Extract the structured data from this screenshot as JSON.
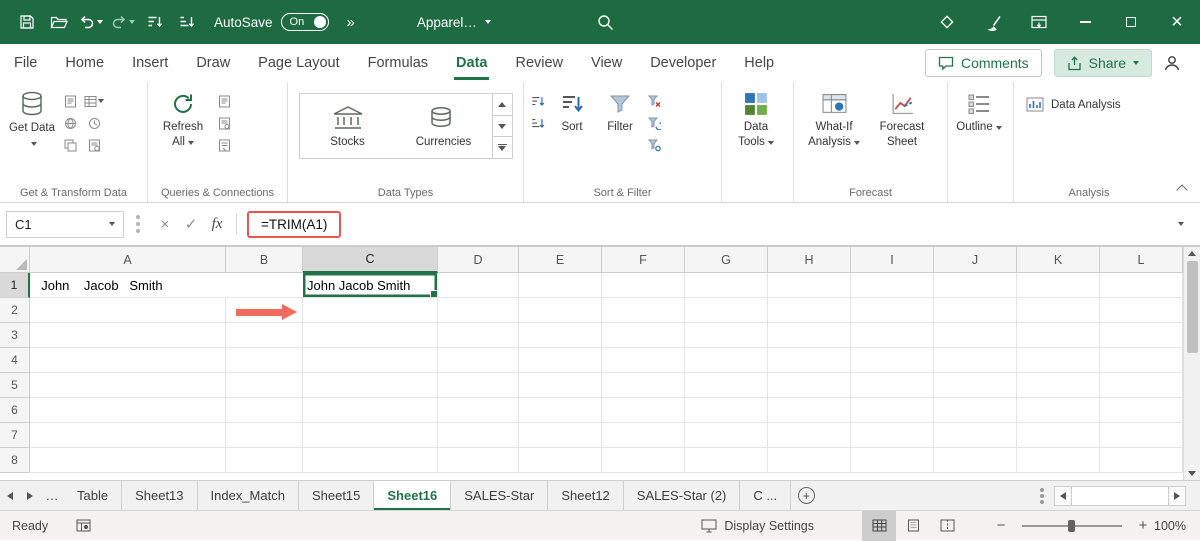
{
  "titlebar": {
    "autosave_label": "AutoSave",
    "autosave_state": "On",
    "overflow_glyph": "»",
    "doc_name": "Apparel…",
    "close_glyph": "×"
  },
  "tabs": {
    "items": [
      "File",
      "Home",
      "Insert",
      "Draw",
      "Page Layout",
      "Formulas",
      "Data",
      "Review",
      "View",
      "Developer",
      "Help"
    ],
    "active": "Data",
    "comments_label": "Comments",
    "share_label": "Share"
  },
  "ribbon": {
    "groups": {
      "get_transform": {
        "label": "Get & Transform Data",
        "get_data": "Get Data"
      },
      "queries": {
        "label": "Queries & Connections",
        "refresh_all": "Refresh All"
      },
      "data_types": {
        "label": "Data Types",
        "items": [
          "Stocks",
          "Currencies"
        ]
      },
      "sort_filter": {
        "label": "Sort & Filter",
        "sort": "Sort",
        "filter": "Filter"
      },
      "data_tools": {
        "button": "Data Tools"
      },
      "forecast": {
        "label": "Forecast",
        "what_if": "What-If Analysis",
        "forecast_sheet": "Forecast Sheet"
      },
      "outline": {
        "button": "Outline"
      },
      "analysis": {
        "label": "Analysis",
        "data_analysis": "Data Analysis"
      }
    }
  },
  "formula_bar": {
    "name_box": "C1",
    "cancel_glyph": "×",
    "enter_glyph": "✓",
    "fx_label": "fx",
    "formula": "=TRIM(A1)"
  },
  "grid": {
    "columns": [
      "A",
      "B",
      "C",
      "D",
      "E",
      "F",
      "G",
      "H",
      "I",
      "J",
      "K",
      "L"
    ],
    "rows": [
      "1",
      "2",
      "3",
      "4",
      "5",
      "6",
      "7",
      "8"
    ],
    "cells": {
      "A1": "  John    Jacob   Smith",
      "C1": "John Jacob Smith"
    },
    "selected_cell": "C1"
  },
  "sheet_bar": {
    "overflow_glyph": "…",
    "tabs": [
      "Table",
      "Sheet13",
      "Index_Match",
      "Sheet15",
      "Sheet16",
      "SALES-Star",
      "Sheet12",
      "SALES-Star (2)",
      "C ..."
    ],
    "active": "Sheet16",
    "new_sheet_glyph": "+"
  },
  "status_bar": {
    "ready_label": "Ready",
    "display_settings_label": "Display Settings",
    "zoom_out_glyph": "−",
    "zoom_in_glyph": "+",
    "zoom_level": "100%"
  },
  "colors": {
    "excel_green": "#217346",
    "title_green": "#1E6B41",
    "annotation_red": "#E8564E"
  }
}
